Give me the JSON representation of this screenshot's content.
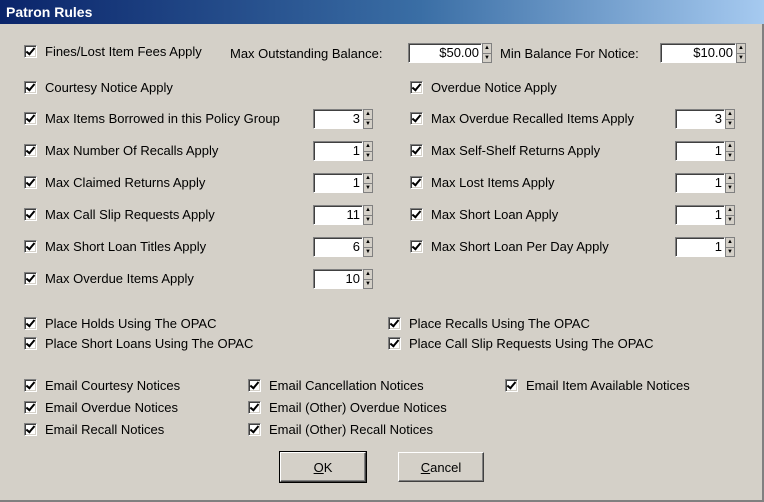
{
  "window": {
    "title": "Patron Rules"
  },
  "top": {
    "fines_label": "Fines/Lost Item Fees Apply",
    "max_outstanding_label": "Max Outstanding Balance:",
    "max_outstanding_value": "$50.00",
    "min_balance_label": "Min Balance For Notice:",
    "min_balance_value": "$10.00",
    "courtesy_label": "Courtesy Notice Apply",
    "overdue_label": "Overdue Notice Apply"
  },
  "left_limits": [
    {
      "label": "Max Items Borrowed in this Policy Group",
      "value": "3"
    },
    {
      "label": "Max Number Of Recalls Apply",
      "value": "1"
    },
    {
      "label": "Max Claimed Returns Apply",
      "value": "1"
    },
    {
      "label": "Max Call Slip Requests Apply",
      "value": "11"
    },
    {
      "label": "Max Short Loan Titles Apply",
      "value": "6"
    },
    {
      "label": "Max Overdue Items Apply",
      "value": "10"
    }
  ],
  "right_limits": [
    {
      "label": "Max Overdue Recalled Items Apply",
      "value": "3"
    },
    {
      "label": "Max Self-Shelf Returns Apply",
      "value": "1"
    },
    {
      "label": "Max Lost Items Apply",
      "value": "1"
    },
    {
      "label": "Max Short Loan Apply",
      "value": "1"
    },
    {
      "label": "Max Short Loan Per Day Apply",
      "value": "1"
    }
  ],
  "opac": {
    "holds": "Place Holds Using The OPAC",
    "short_loans": "Place Short Loans Using The OPAC",
    "recalls": "Place Recalls Using The OPAC",
    "call_slip": "Place Call Slip Requests Using The OPAC"
  },
  "email": {
    "courtesy": "Email Courtesy Notices",
    "overdue": "Email Overdue Notices",
    "recall": "Email Recall Notices",
    "cancellation": "Email Cancellation Notices",
    "other_overdue": "Email (Other) Overdue Notices",
    "other_recall": "Email (Other) Recall Notices",
    "item_available": "Email Item Available Notices"
  },
  "buttons": {
    "ok_mnemonic": "O",
    "ok_rest": "K",
    "cancel_mnemonic": "C",
    "cancel_rest": "ancel"
  },
  "icons": {
    "spin_up": "up-arrow-icon",
    "spin_down": "down-arrow-icon",
    "check": "checkmark-icon"
  }
}
